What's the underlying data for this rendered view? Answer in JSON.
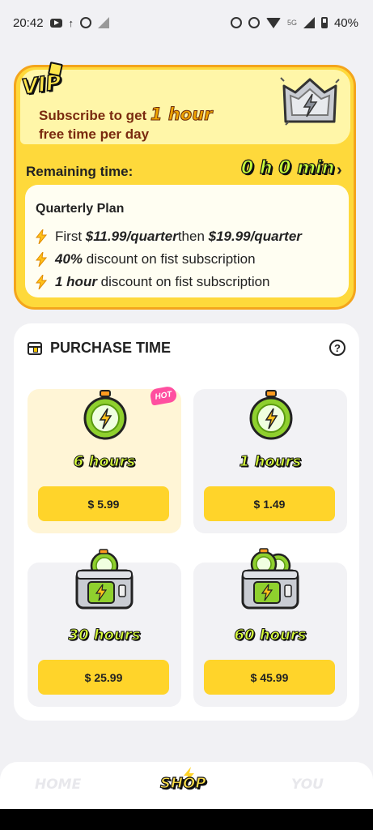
{
  "status_bar": {
    "time": "20:42",
    "network": "5G",
    "battery": "40%"
  },
  "vip": {
    "badge": "VIP",
    "subscribe_prefix": "Subscribe to get ",
    "subscribe_highlight": "1 hour",
    "subscribe_line2": "free time per day",
    "remaining_label": "Remaining time:",
    "remaining_value": "0 h 0 min",
    "plan": {
      "title": "Quarterly Plan",
      "line1_prefix": "First ",
      "line1_price1": "$11.99/quarter",
      "line1_mid": "then ",
      "line1_price2": "$19.99/quarter",
      "line2_bold": "40%",
      "line2_rest": " discount on fist subscription",
      "line3_bold": "1 hour",
      "line3_rest": " discount on fist subscription"
    }
  },
  "purchase": {
    "title": "PURCHASE TIME",
    "help": "?",
    "tiles": [
      {
        "hours": "6 hours",
        "price": "$ 5.99",
        "badge": "HOT",
        "art": "stopwatch"
      },
      {
        "hours": "1 hours",
        "price": "$ 1.49",
        "art": "stopwatch"
      },
      {
        "hours": "30 hours",
        "price": "$ 25.99",
        "art": "chest-one-watch"
      },
      {
        "hours": "60 hours",
        "price": "$ 45.99",
        "art": "chest-two-watches"
      }
    ]
  },
  "nav": {
    "home": "HOME",
    "shop": "SHOP",
    "you": "YOU",
    "active": "SHOP"
  },
  "colors": {
    "vip_yellow": "#fed93b",
    "accent_lime": "#c7ff3a",
    "button_yellow": "#ffd42a",
    "hot_pink": "#ff4fa0"
  }
}
